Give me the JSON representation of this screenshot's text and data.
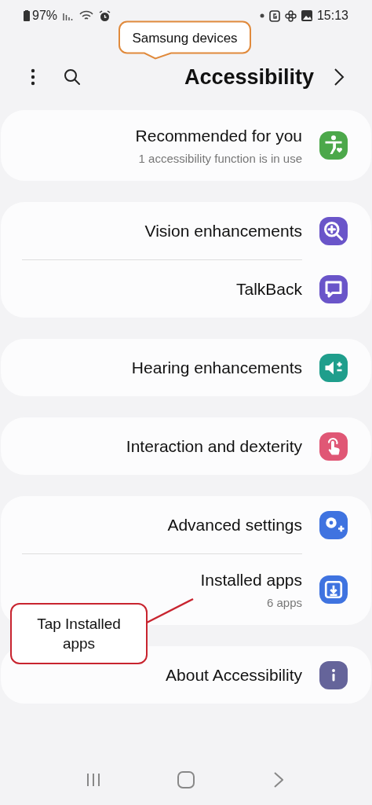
{
  "status_bar": {
    "battery": "97%",
    "time": "15:13"
  },
  "header": {
    "title": "Accessibility"
  },
  "groups": [
    {
      "items": [
        {
          "title": "Recommended for you",
          "subtitle": "1 accessibility function is in use",
          "color": "#4ca84a"
        }
      ]
    },
    {
      "items": [
        {
          "title": "Vision enhancements",
          "color": "#6a55c9"
        },
        {
          "title": "TalkBack",
          "color": "#6a55c9"
        }
      ]
    },
    {
      "items": [
        {
          "title": "Hearing enhancements",
          "color": "#1f9e8c"
        }
      ]
    },
    {
      "items": [
        {
          "title": "Interaction and dexterity",
          "color": "#e05775"
        }
      ]
    },
    {
      "items": [
        {
          "title": "Advanced settings",
          "color": "#3f73e0"
        },
        {
          "title": "Installed apps",
          "subtitle": "6 apps",
          "color": "#3f73e0"
        }
      ]
    },
    {
      "items": [
        {
          "title": "About Accessibility",
          "color": "#65649a"
        }
      ]
    }
  ],
  "annotations": [
    {
      "text": "Samsung devices",
      "color": "#e08a3c"
    },
    {
      "text": "Tap Installed apps",
      "color": "#c8242f"
    }
  ]
}
